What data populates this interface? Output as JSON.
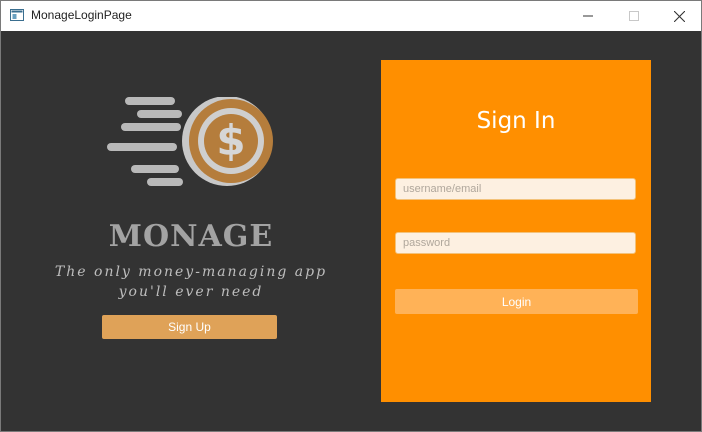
{
  "window": {
    "title": "MonageLoginPage",
    "controls": {
      "minimize": "minimize-icon",
      "maximize": "maximize-icon",
      "close": "close-icon"
    }
  },
  "left": {
    "logo_icon": "money-speed-icon",
    "brand": "MONAGE",
    "tagline_line1": "The only money-managing app",
    "tagline_line2": "you'll ever need",
    "signup_label": "Sign Up"
  },
  "signin": {
    "title": "Sign In",
    "username_placeholder": "username/email",
    "username_value": "",
    "password_placeholder": "password",
    "password_value": "",
    "login_label": "Login"
  },
  "colors": {
    "background": "#333333",
    "panel": "#ff8f00",
    "signup_button": "#dfa258",
    "login_button": "#ffb257",
    "coin": "#b57d3c",
    "brand_text": "#a3a3a3"
  }
}
